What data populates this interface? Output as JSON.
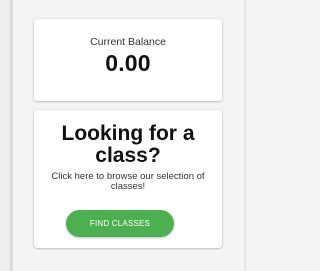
{
  "balance": {
    "label": "Current Balance",
    "value": "0.00"
  },
  "class_promo": {
    "title": "Looking for a class?",
    "description": "Click here to browse our selection of classes!",
    "button_label": "FIND CLASSES"
  },
  "colors": {
    "button_green": "#4caf50",
    "card_background": "#ffffff",
    "page_background": "#f4f4f4"
  }
}
